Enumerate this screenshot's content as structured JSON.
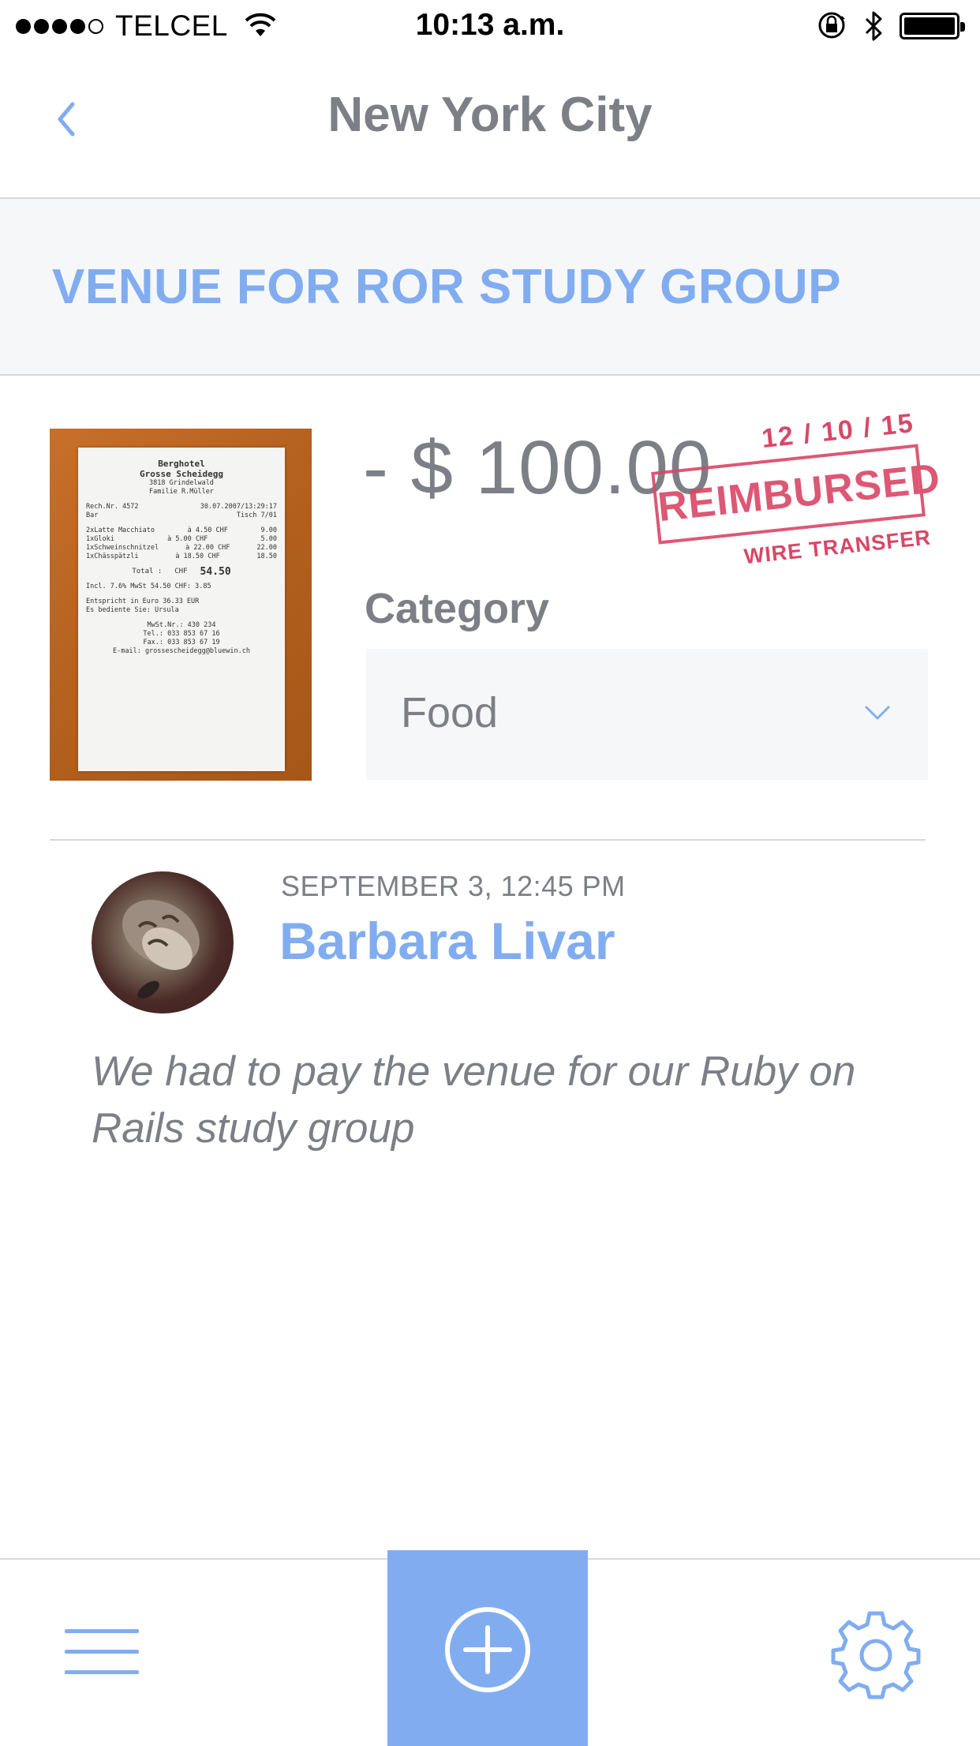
{
  "status_bar": {
    "carrier": "TELCEL",
    "time": "10:13 a.m."
  },
  "nav": {
    "title": "New York City",
    "back_icon": "chevron-left-icon"
  },
  "expense": {
    "title": "VENUE FOR ROR STUDY GROUP",
    "amount": "- $ 100.00",
    "stamp": {
      "date": "12 / 10 / 15",
      "status": "REIMBURSED",
      "method": "WIRE TRANSFER",
      "color": "#d94767"
    },
    "category_label": "Category",
    "category_value": "Food"
  },
  "receipt": {
    "header_1": "Berghotel",
    "header_2": "Grosse Scheidegg",
    "address": "3818 Grindelwald",
    "family": "Familie R.Müller",
    "rech_nr": "Rech.Nr. 4572",
    "datetime": "30.07.2007/13:29:17",
    "bar": "Bar",
    "tisch": "Tisch 7/01",
    "items": [
      {
        "name": "2xLatte Macchiato",
        "unit": "à 4.50 CHF",
        "total": "9.00"
      },
      {
        "name": "1xGloki",
        "unit": "à 5.00 CHF",
        "total": "5.00"
      },
      {
        "name": "1xSchweinschnitzel",
        "unit": "à 22.00 CHF",
        "total": "22.00"
      },
      {
        "name": "1xChässpätzli",
        "unit": "à 18.50 CHF",
        "total": "18.50"
      }
    ],
    "total_label": "Total :",
    "total_currency": "CHF",
    "total_value": "54.50",
    "mwst": "Incl. 7.6% MwSt 54.50 CHF: 3.85",
    "euro": "Entspricht in Euro 36.33 EUR",
    "served_by": "Es bediente Sie: Ursula",
    "mwst_nr": "MwSt.Nr.: 430 234",
    "tel": "Tel.: 033 853 67 16",
    "fax": "Fax.: 033 853 67 19",
    "email": "E-mail: grossescheidegg@bluewin.ch"
  },
  "comment": {
    "date": "SEPTEMBER 3, 12:45 PM",
    "author": "Barbara Livar",
    "text": "We had to pay the venue for our Ruby on Rails study group"
  },
  "tab_bar": {
    "menu_icon": "hamburger-menu-icon",
    "add_icon": "plus-circle-icon",
    "settings_icon": "gear-icon"
  },
  "colors": {
    "accent": "#81adf0",
    "text": "#7d7f86",
    "stamp": "#d94767",
    "divider": "#d6d8db",
    "panel": "#f6f7f8"
  }
}
